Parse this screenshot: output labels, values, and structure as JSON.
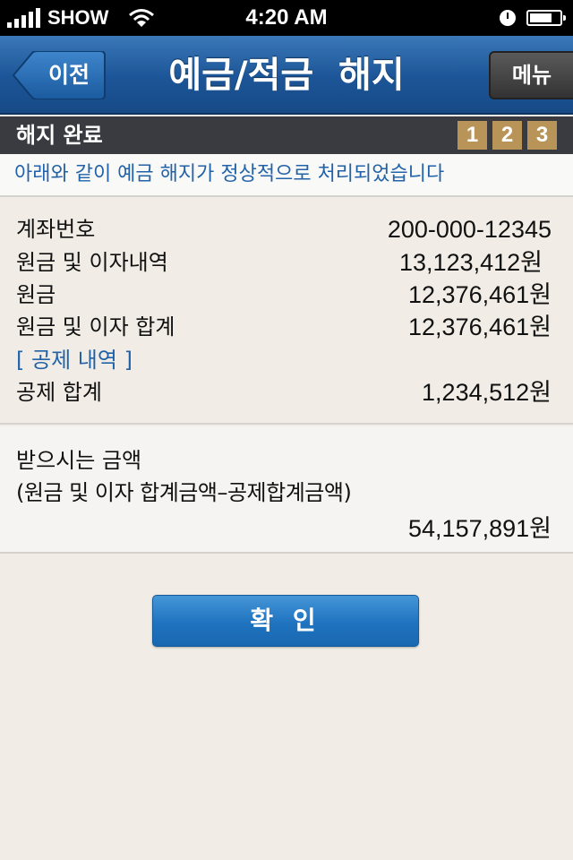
{
  "status_bar": {
    "carrier": "SHOW",
    "time": "4:20 AM"
  },
  "nav": {
    "back_label": "이전",
    "title": "예금/적금  해지",
    "menu_label": "메뉴"
  },
  "step_header": {
    "title": "해지 완료",
    "steps": [
      "1",
      "2",
      "3"
    ]
  },
  "notice": "아래와 같이 예금 해지가 정상적으로 처리되었습니다",
  "details": [
    {
      "label": "계좌번호",
      "value": "200-000-12345"
    },
    {
      "label": "원금 및 이자내역",
      "value": "13,123,412원"
    },
    {
      "label": "원금",
      "value": "12,376,461원"
    },
    {
      "label": "원금 및 이자 합계",
      "value": "12,376,461원"
    },
    {
      "label": "[ 공제 내역 ]",
      "value": ""
    },
    {
      "label": "공제 합계",
      "value": "1,234,512원"
    }
  ],
  "receive": {
    "title": "받으시는 금액",
    "subtitle": "(원금 및 이자 합계금액–공제합계금액)",
    "amount": "54,157,891원"
  },
  "confirm_label": "확 인",
  "colors": {
    "nav_blue": "#1c5597",
    "step_badge": "#b99458",
    "notice_text": "#2162a8",
    "button_blue": "#1f73bf"
  }
}
